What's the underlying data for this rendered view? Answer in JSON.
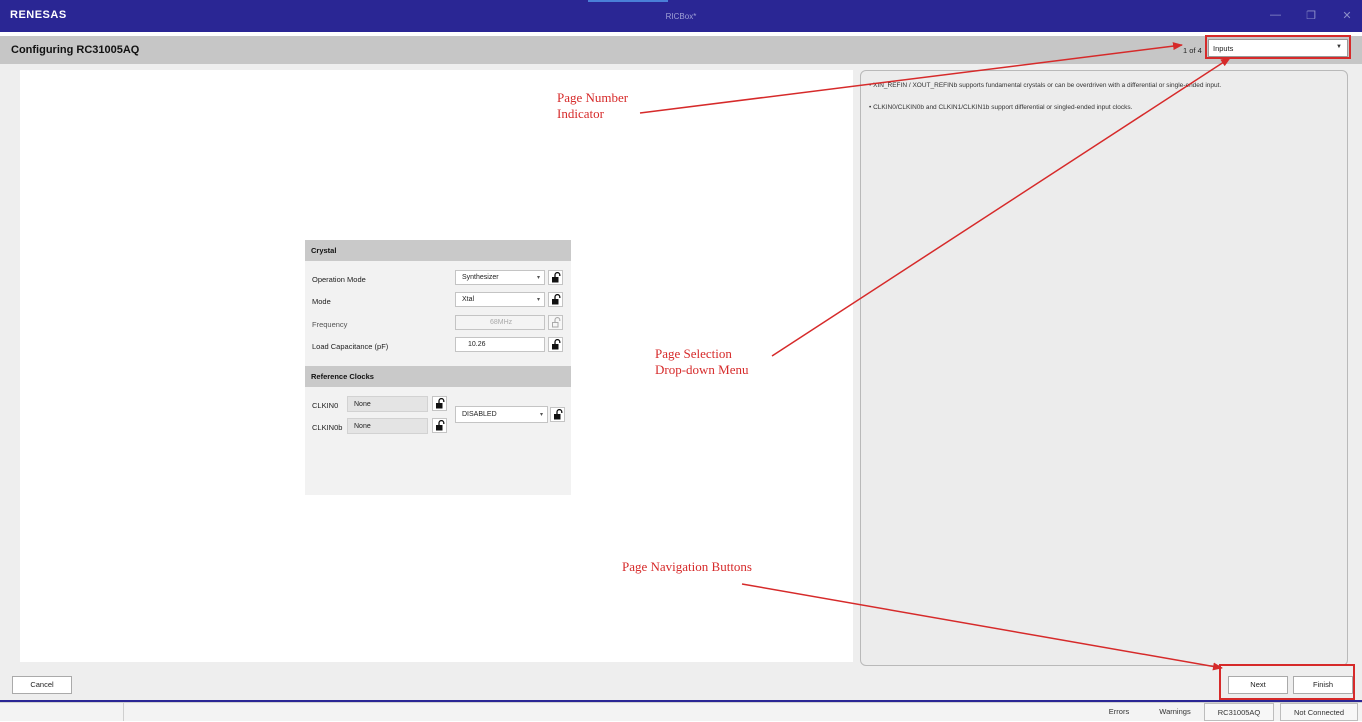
{
  "window": {
    "logo": "RENESAS",
    "app_title": "RICBox*",
    "min_glyph": "—",
    "max_glyph": "❐",
    "close_glyph": "✕"
  },
  "header": {
    "title": "Configuring RC31005AQ",
    "page_indicator": "1 of 4",
    "page_select_value": "Inputs"
  },
  "crystal": {
    "section_title": "Crystal",
    "operation_mode_label": "Operation Mode",
    "operation_mode_value": "Synthesizer",
    "mode_label": "Mode",
    "mode_value": "Xtal",
    "frequency_label": "Frequency",
    "frequency_value": "68MHz",
    "load_cap_label": "Load Capacitance (pF)",
    "load_cap_value": "10.26"
  },
  "reference_clocks": {
    "section_title": "Reference Clocks",
    "clkin0_label": "CLKIN0",
    "clkin0_value": "None",
    "clkin0b_label": "CLKIN0b",
    "clkin0b_value": "None",
    "mode_value": "DISABLED"
  },
  "help": {
    "line1": "• XIN_REFIN / XOUT_REFINb supports fundamental crystals or can be overdriven with a differential or single-ended input.",
    "line2": "• CLKIN0/CLKIN0b and CLKIN1/CLKIN1b support differential or singled-ended input clocks."
  },
  "footer": {
    "cancel_label": "Cancel",
    "next_label": "Next",
    "finish_label": "Finish"
  },
  "statusbar": {
    "errors": "Errors",
    "warnings": "Warnings",
    "device": "RC31005AQ",
    "connection": "Not Connected"
  },
  "annotations": {
    "page_number_line1": "Page Number",
    "page_number_line2": "Indicator",
    "page_selection_line1": "Page Selection",
    "page_selection_line2": "Drop-down Menu",
    "nav_buttons": "Page Navigation Buttons",
    "color": "#d62a2a"
  }
}
